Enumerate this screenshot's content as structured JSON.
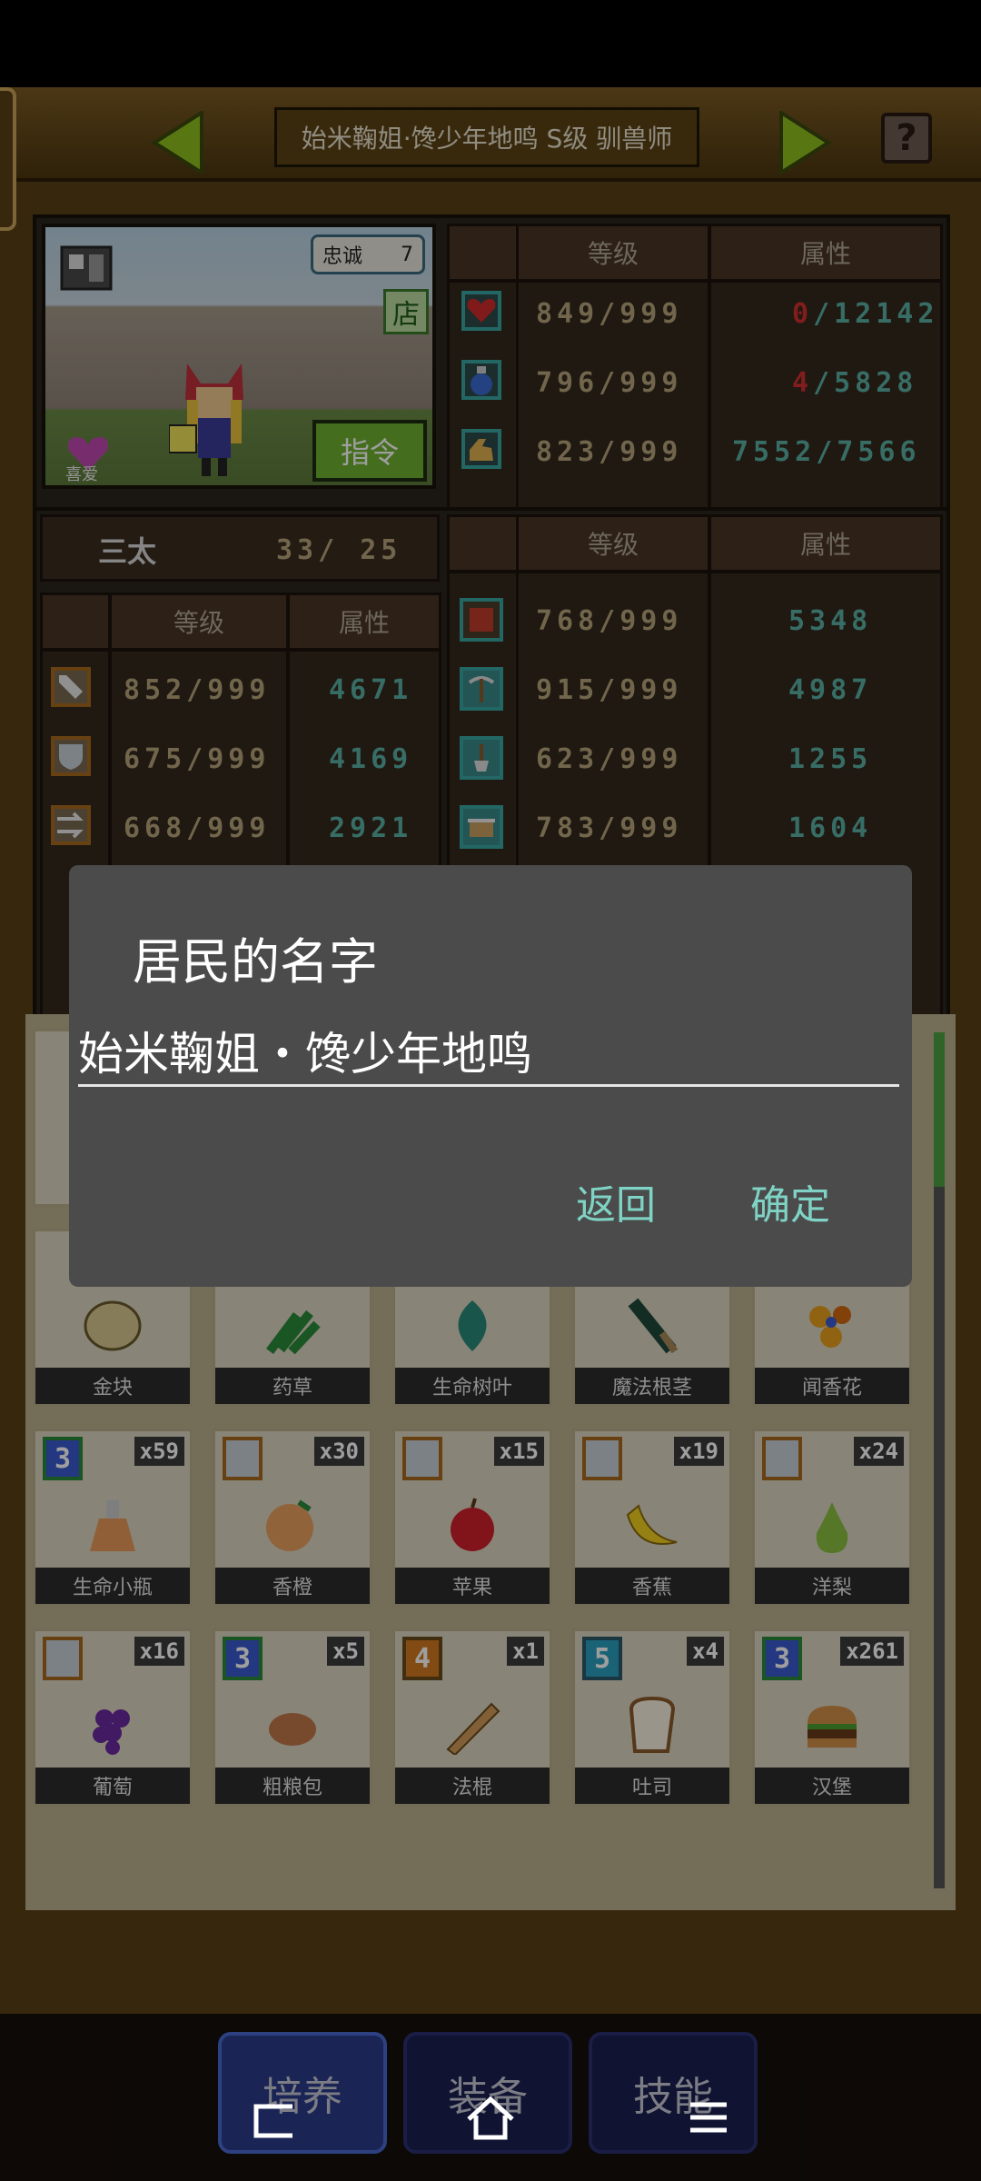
{
  "header": {
    "title": "始米鞠姐·馋少年地鸣 S级 驯兽师",
    "prev_icon": "left-arrow-icon",
    "next_icon": "right-arrow-icon",
    "help_label": "?"
  },
  "portrait": {
    "loyalty_label": "忠诚",
    "loyalty_value": "7",
    "shop_label": "店",
    "command_label": "指令",
    "like_label": "喜爱"
  },
  "vitals": {
    "col_level": "等级",
    "col_attr": "属性",
    "rows": [
      {
        "icon": "heart-icon",
        "level": "849/999",
        "attr_cur": "0",
        "attr_max": "/12142"
      },
      {
        "icon": "potion-icon",
        "level": "796/999",
        "attr_cur": "4",
        "attr_max": "/5828"
      },
      {
        "icon": "strength-arm-icon",
        "level": "823/999",
        "attr_cur": "7552",
        "attr_max": "/7566"
      }
    ]
  },
  "rank": {
    "label": "三太",
    "value": "33/ 25"
  },
  "combat": {
    "col_level": "等级",
    "col_attr": "属性",
    "rows": [
      {
        "icon": "sword-icon",
        "level": "852/999",
        "attr": "4671"
      },
      {
        "icon": "shield-icon",
        "level": "675/999",
        "attr": "4169"
      },
      {
        "icon": "speed-arrows-icon",
        "level": "668/999",
        "attr": "2921"
      }
    ]
  },
  "skills": {
    "col_level": "等级",
    "col_attr": "属性",
    "rows": [
      {
        "icon": "book-icon",
        "level": "768/999",
        "attr": "5348"
      },
      {
        "icon": "pickaxe-icon",
        "level": "915/999",
        "attr": "4987"
      },
      {
        "icon": "shovel-icon",
        "level": "623/999",
        "attr": "1255"
      },
      {
        "icon": "pot-icon",
        "level": "783/999",
        "attr": "1604"
      }
    ]
  },
  "items": {
    "row1": [
      {
        "name": "金块"
      },
      {
        "name": "药草"
      },
      {
        "name": "生命树叶"
      },
      {
        "name": "魔法根茎"
      },
      {
        "name": "闻香花"
      }
    ],
    "row2": [
      {
        "name": "生命小瓶",
        "badge": "3",
        "count": "x59"
      },
      {
        "name": "香橙",
        "badge": "shield",
        "count": "x30"
      },
      {
        "name": "苹果",
        "badge": "shield",
        "count": "x15"
      },
      {
        "name": "香蕉",
        "badge": "shield",
        "count": "x19"
      },
      {
        "name": "洋梨",
        "badge": "shield",
        "count": "x24"
      }
    ],
    "row3": [
      {
        "name": "葡萄",
        "badge": "shield",
        "count": "x16"
      },
      {
        "name": "粗粮包",
        "badge": "3",
        "count": "x5"
      },
      {
        "name": "法棍",
        "badge": "4",
        "count": "x1"
      },
      {
        "name": "吐司",
        "badge": "5",
        "count": "x4"
      },
      {
        "name": "汉堡",
        "badge": "3",
        "count": "x261"
      }
    ]
  },
  "dialog": {
    "title": "居民的名字",
    "input_value": "始米鞠姐・馋少年地鸣",
    "cancel_label": "返回",
    "ok_label": "确定"
  },
  "tabs": [
    {
      "label": "培养"
    },
    {
      "label": "装备"
    },
    {
      "label": "技能"
    }
  ],
  "navbar": {
    "back_icon": "back-icon",
    "home_icon": "home-icon",
    "menu_icon": "menu-icon"
  },
  "colors": {
    "accent": "#7fd3c4",
    "panel": "#2b241c",
    "gold_bg": "#5a4216"
  }
}
